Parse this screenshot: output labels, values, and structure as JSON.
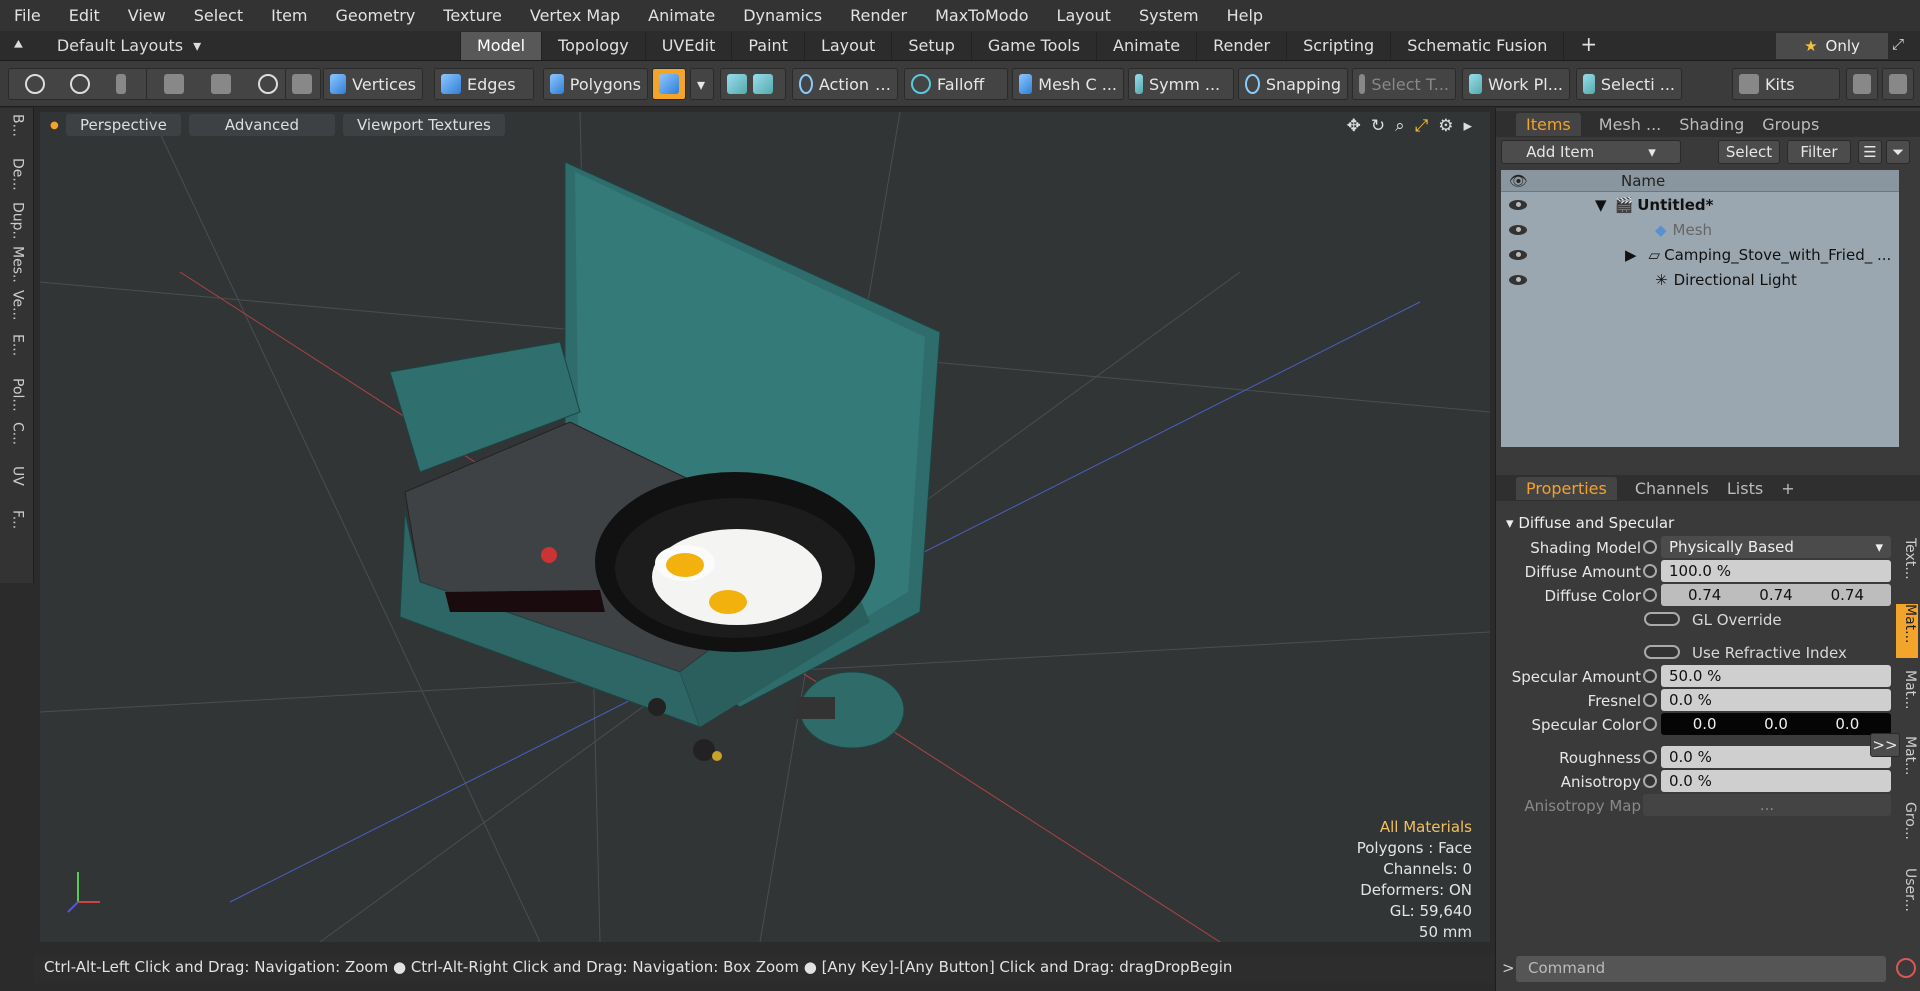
{
  "menu": [
    "File",
    "Edit",
    "View",
    "Select",
    "Item",
    "Geometry",
    "Texture",
    "Vertex Map",
    "Animate",
    "Dynamics",
    "Render",
    "MaxToModo",
    "Layout",
    "System",
    "Help"
  ],
  "layouts": "Default Layouts",
  "tabs": [
    "Model",
    "Topology",
    "UVEdit",
    "Paint",
    "Layout",
    "Setup",
    "Game Tools",
    "Animate",
    "Render",
    "Scripting",
    "Schematic Fusion"
  ],
  "active_tab": "Model",
  "only_label": "Only",
  "toolbar": {
    "vertices": "Vertices",
    "edges": "Edges",
    "polygons": "Polygons",
    "action": "Action",
    "falloff": "Falloff",
    "mesh": "Mesh C ...",
    "symm": "Symm ...",
    "snapping": "Snapping",
    "select_t": "Select T...",
    "workplane": "Work Pl...",
    "selecti": "Selecti ...",
    "kits": "Kits"
  },
  "left_strip": [
    "B...",
    "De...",
    "Dup...",
    "Mes...",
    "Ve...",
    "E...",
    "Pol...",
    "C...",
    "UV",
    "F..."
  ],
  "viewport": {
    "perspective": "Perspective",
    "advanced": "Advanced",
    "textures": "Viewport Textures",
    "info": {
      "materials": "All Materials",
      "polygons": "Polygons : Face",
      "channels": "Channels: 0",
      "deformers": "Deformers: ON",
      "gl": "GL: 59,640",
      "mm": "50 mm"
    }
  },
  "status": "Ctrl-Alt-Left Click and Drag: Navigation: Zoom ● Ctrl-Alt-Right Click and Drag: Navigation: Box Zoom ● [Any Key]-[Any Button] Click and Drag: dragDropBegin",
  "panel": {
    "tabs": [
      "Items",
      "Mesh ...",
      "Shading",
      "Groups"
    ],
    "add_item": "Add Item",
    "select": "Select",
    "filter": "Filter",
    "name_col": "Name",
    "items": [
      "Untitled*",
      "Mesh",
      "Camping_Stove_with_Fried_ ...",
      "Directional Light"
    ]
  },
  "props": {
    "tabs": [
      "Properties",
      "Channels",
      "Lists"
    ],
    "section": "Diffuse and Specular",
    "shading_model_label": "Shading Model",
    "shading_model": "Physically Based",
    "diffuse_amount_label": "Diffuse Amount",
    "diffuse_amount": "100.0 %",
    "diffuse_color_label": "Diffuse Color",
    "diffuse_color": [
      "0.74",
      "0.74",
      "0.74"
    ],
    "gl_override": "GL Override",
    "refractive": "Use Refractive Index",
    "spec_amount_label": "Specular Amount",
    "spec_amount": "50.0 %",
    "fresnel_label": "Fresnel",
    "fresnel": "0.0 %",
    "spec_color_label": "Specular Color",
    "spec_color": [
      "0.0",
      "0.0",
      "0.0"
    ],
    "roughness_label": "Roughness",
    "roughness": "0.0 %",
    "aniso_label": "Anisotropy",
    "aniso": "0.0 %",
    "aniso_map_label": "Anisotropy Map",
    "aniso_map": "...",
    "vtabs": [
      "Text...",
      "Mat...",
      "Mat...",
      "Mat...",
      "Gro...",
      "User..."
    ],
    "command": "Command"
  }
}
